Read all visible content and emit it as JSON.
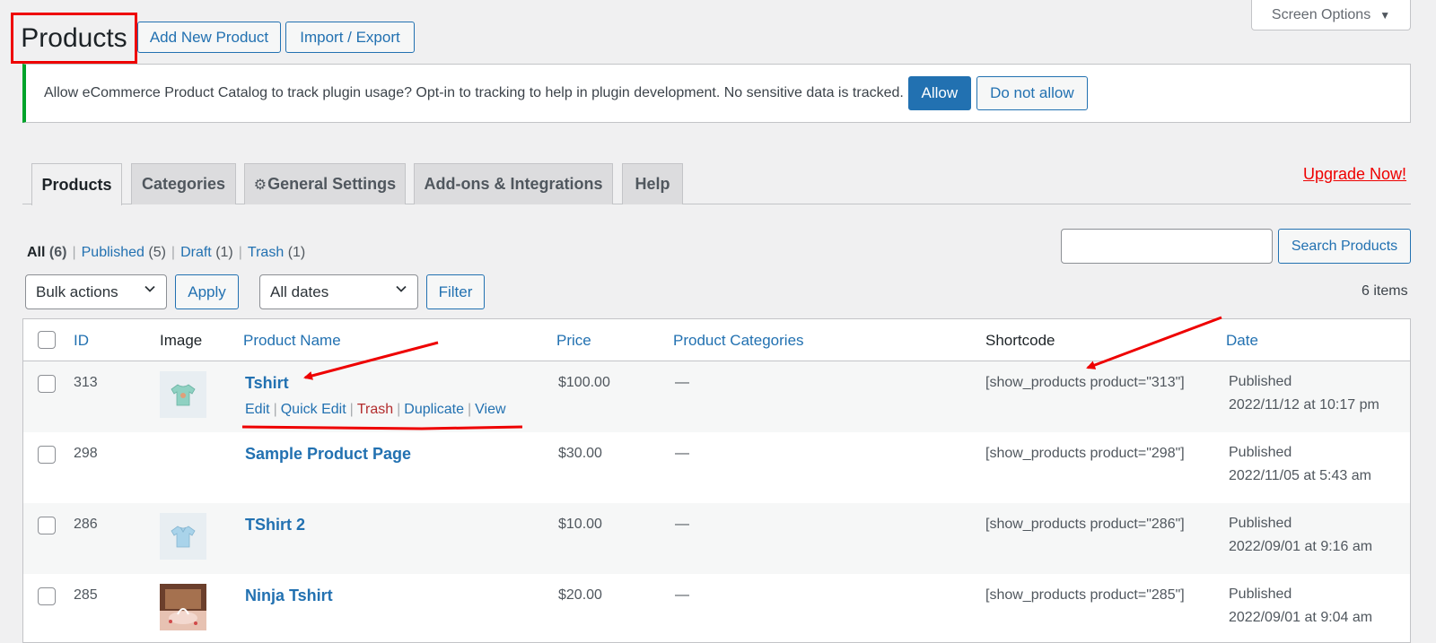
{
  "header": {
    "title": "Products",
    "add_new": "Add New Product",
    "import_export": "Import / Export",
    "screen_options": "Screen Options"
  },
  "notice": {
    "text": "Allow eCommerce Product Catalog to track plugin usage? Opt-in to tracking to help in plugin development. No sensitive data is tracked.",
    "allow": "Allow",
    "deny": "Do not allow",
    "accent_color": "#00a32a"
  },
  "tabs": [
    {
      "label": "Products",
      "active": true
    },
    {
      "label": "Categories",
      "active": false
    },
    {
      "label": "General Settings",
      "active": false,
      "icon": "gear-icon"
    },
    {
      "label": "Add-ons & Integrations",
      "active": false
    },
    {
      "label": "Help",
      "active": false
    }
  ],
  "upgrade": "Upgrade Now!",
  "views": {
    "all": "All",
    "all_count": "(6)",
    "published": "Published",
    "published_count": "(5)",
    "draft": "Draft",
    "draft_count": "(1)",
    "trash": "Trash",
    "trash_count": "(1)"
  },
  "search": {
    "value": "",
    "button": "Search Products"
  },
  "bulk": {
    "selected": "Bulk actions",
    "apply": "Apply"
  },
  "dates": {
    "selected": "All dates",
    "filter": "Filter"
  },
  "items_count": "6 items",
  "table": {
    "headers": {
      "id": "ID",
      "image": "Image",
      "name": "Product Name",
      "price": "Price",
      "categories": "Product Categories",
      "shortcode": "Shortcode",
      "date": "Date"
    },
    "row_actions": {
      "edit": "Edit",
      "quick_edit": "Quick Edit",
      "trash": "Trash",
      "duplicate": "Duplicate",
      "view": "View"
    },
    "rows": [
      {
        "id": "313",
        "image": "tshirt-green",
        "name": "Tshirt",
        "price": "$100.00",
        "categories": "—",
        "shortcode": "[show_products product=\"313\"]",
        "status": "Published",
        "date": "2022/11/12 at 10:17 pm"
      },
      {
        "id": "298",
        "image": "",
        "name": "Sample Product Page",
        "price": "$30.00",
        "categories": "—",
        "shortcode": "[show_products product=\"298\"]",
        "status": "Published",
        "date": "2022/11/05 at 5:43 am"
      },
      {
        "id": "286",
        "image": "tshirt-blue",
        "name": "TShirt 2",
        "price": "$10.00",
        "categories": "—",
        "shortcode": "[show_products product=\"286\"]",
        "status": "Published",
        "date": "2022/09/01 at 9:16 am"
      },
      {
        "id": "285",
        "image": "photo",
        "name": "Ninja Tshirt",
        "price": "$20.00",
        "categories": "—",
        "shortcode": "[show_products product=\"285\"]",
        "status": "Published",
        "date": "2022/09/01 at 9:04 am"
      }
    ]
  }
}
